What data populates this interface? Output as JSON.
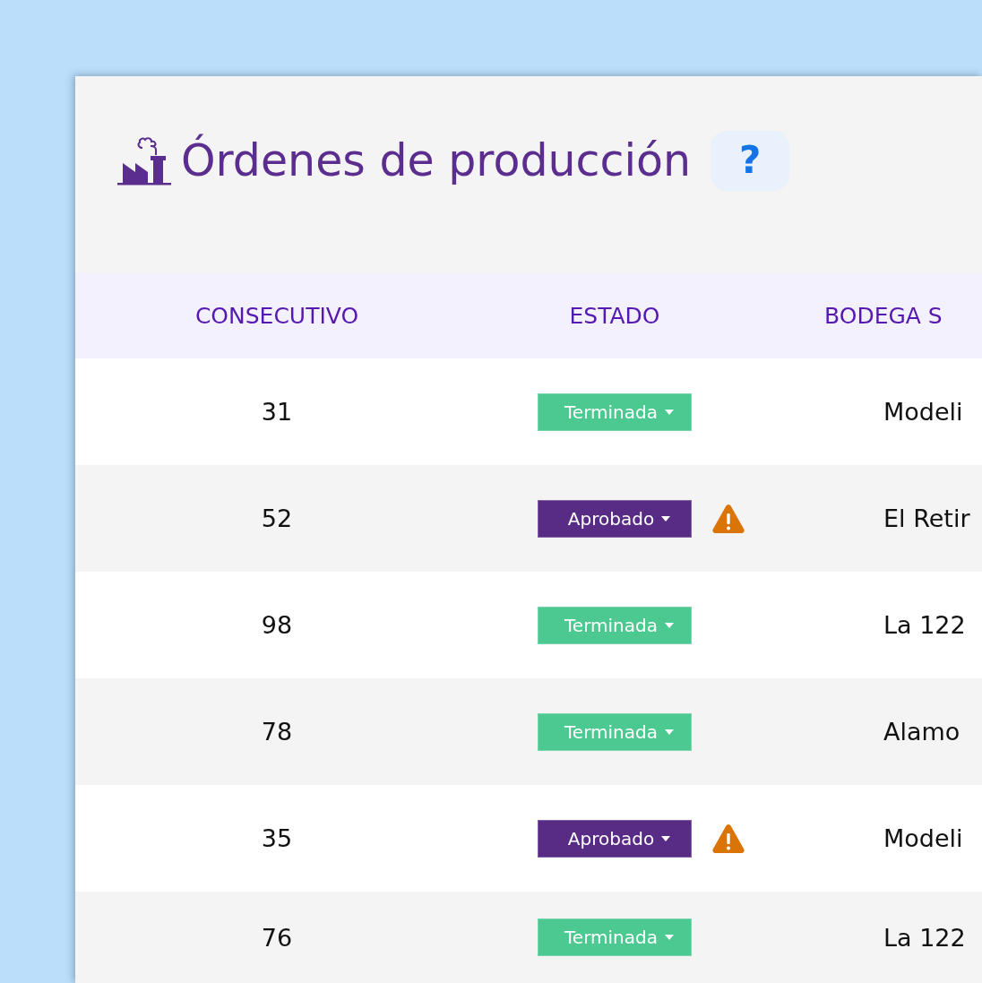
{
  "page": {
    "title": "Órdenes de producción",
    "help_button": "?"
  },
  "table": {
    "columns": [
      "CONSECUTIVO",
      "ESTADO",
      "BODEGA S"
    ],
    "rows": [
      {
        "consecutivo": "31",
        "status": {
          "label": "Terminada",
          "kind": "finished"
        },
        "warning": false,
        "bodega": "Modeli"
      },
      {
        "consecutivo": "52",
        "status": {
          "label": "Aprobado",
          "kind": "approved"
        },
        "warning": true,
        "bodega": "El Retir"
      },
      {
        "consecutivo": "98",
        "status": {
          "label": "Terminada",
          "kind": "finished"
        },
        "warning": false,
        "bodega": "La 122"
      },
      {
        "consecutivo": "78",
        "status": {
          "label": "Terminada",
          "kind": "finished"
        },
        "warning": false,
        "bodega": "Alamo"
      },
      {
        "consecutivo": "35",
        "status": {
          "label": "Aprobado",
          "kind": "approved"
        },
        "warning": true,
        "bodega": "Modeli"
      },
      {
        "consecutivo": "76",
        "status": {
          "label": "Terminada",
          "kind": "finished"
        },
        "warning": false,
        "bodega": "La 122"
      }
    ]
  }
}
